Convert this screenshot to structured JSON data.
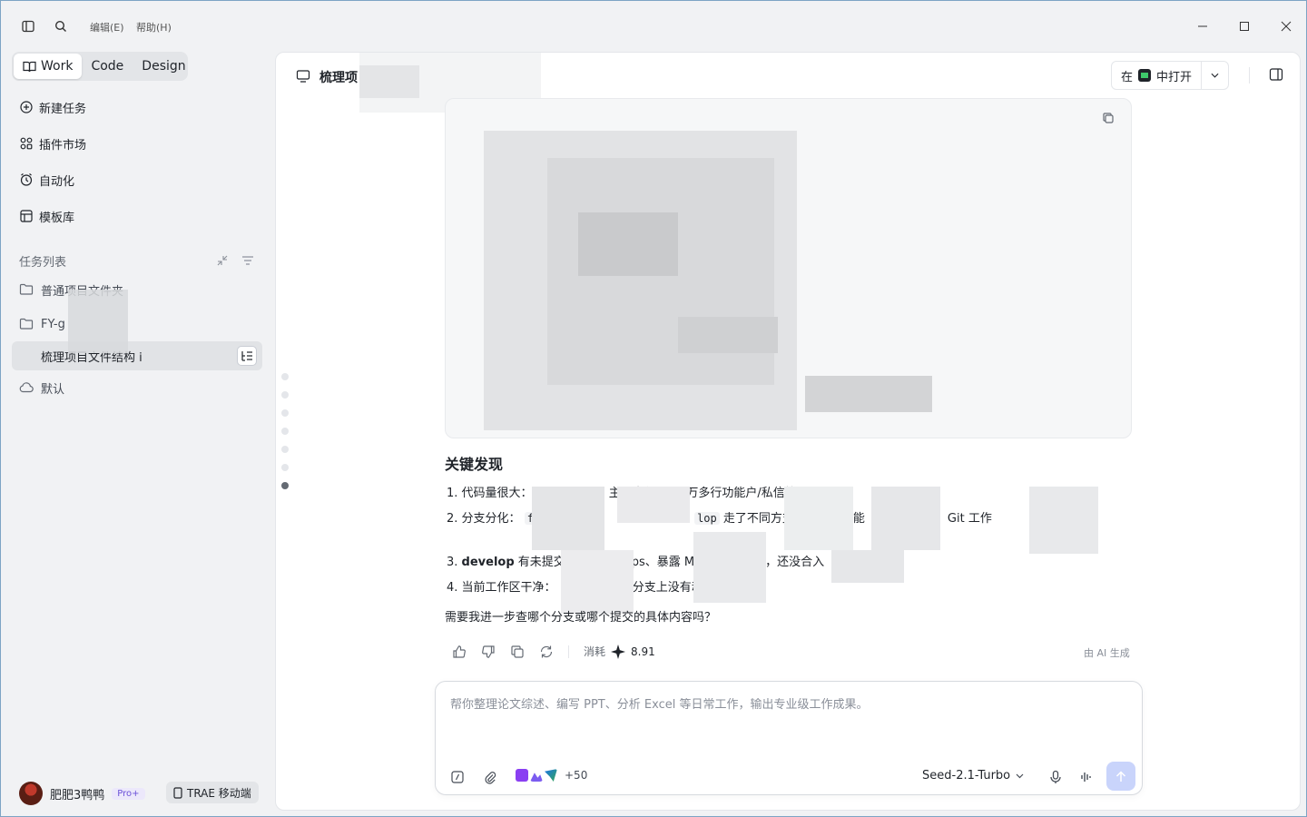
{
  "titlebar": {
    "menu_edit": "编辑(E)",
    "menu_help": "帮助(H)",
    "icons": [
      "sidebar-toggle-icon",
      "search-icon",
      "minimize-icon",
      "maximize-icon",
      "close-icon"
    ]
  },
  "sidebar": {
    "modes": [
      {
        "label": "Work",
        "active": true
      },
      {
        "label": "Code",
        "active": false
      },
      {
        "label": "Design",
        "active": false
      }
    ],
    "nav": [
      {
        "label": "新建任务",
        "icon": "plus-circle-icon"
      },
      {
        "label": "插件市场",
        "icon": "apps-icon"
      },
      {
        "label": "自动化",
        "icon": "clock-icon"
      },
      {
        "label": "模板库",
        "icon": "template-icon"
      }
    ],
    "tasks_title": "任务列表",
    "tasks": [
      {
        "label": "普通项目文件夹",
        "icon": "folder-icon"
      },
      {
        "label": "FY-g",
        "icon": "folder-icon"
      },
      {
        "label": "梳理项目文件结构 i",
        "selected": true
      },
      {
        "label": "默认",
        "icon": "cloud-icon"
      }
    ]
  },
  "user": {
    "name": "肥肥3鸭鸭",
    "badge": "Pro+",
    "mobile_label": "TRAE 移动端"
  },
  "main": {
    "title": "梳理项",
    "open_in_prefix": "在",
    "open_in_suffix": "中打开",
    "findings_title": "关键发现",
    "findings": [
      {
        "num": "1.",
        "label": "代码量很大：",
        "text": "主要文件、17 万多行功能户/私信等）都里"
      },
      {
        "num": "2.",
        "label": "分支分化：",
        "code1": "f",
        "code2": "lop",
        "text": "走了不同方支比了一些功能（如面板增强、Git 工作"
      },
      {
        "num": "3.",
        "label": "develop",
        "text": "有未提交里存了「移ops、暴露 M端口」的修改，还没合入"
      },
      {
        "num": "4.",
        "label": "当前工作区干净：",
        "text": "分支上没有动"
      }
    ],
    "question": "需要我进一步查哪个分支或哪个提交的具体内容吗？",
    "cost_label": "消耗",
    "cost_value": "8.91",
    "ai_label": "由 AI 生成"
  },
  "composer": {
    "placeholder": "帮你整理论文综述、编写 PPT、分析 Excel 等日常工作，输出专业级工作成果。",
    "plus_count": "+50",
    "model": "Seed-2.1-Turbo"
  },
  "colors": {
    "accent": "#3b6df6",
    "send_disabled": "#c9d4fb",
    "pro_badge": "#6b51d8"
  }
}
